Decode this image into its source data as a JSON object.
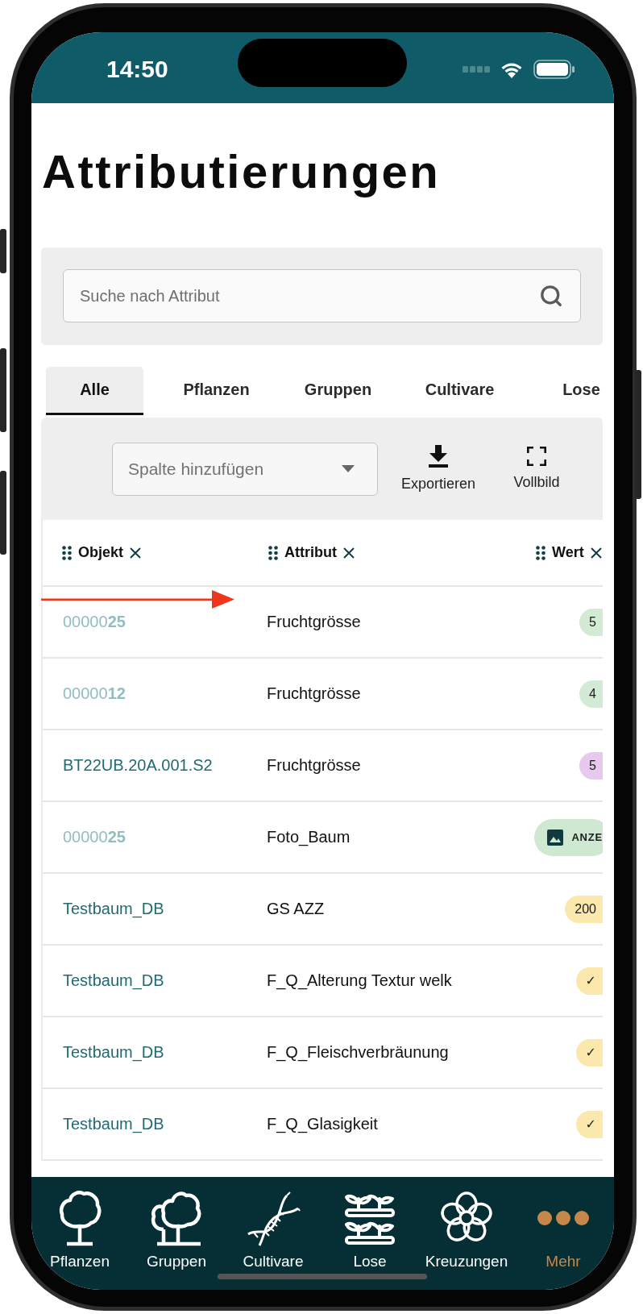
{
  "status_bar": {
    "time": "14:50"
  },
  "title": "Attributierungen",
  "search": {
    "placeholder": "Suche nach Attribut"
  },
  "tabs": [
    {
      "label": "Alle",
      "selected": true
    },
    {
      "label": "Pflanzen",
      "selected": false
    },
    {
      "label": "Gruppen",
      "selected": false
    },
    {
      "label": "Cultivare",
      "selected": false
    },
    {
      "label": "Lose",
      "selected": false
    }
  ],
  "toolbar": {
    "column_select": {
      "placeholder": "Spalte hinzufügen"
    },
    "buttons": [
      {
        "label": "Exportieren",
        "kind": "export"
      },
      {
        "label": "Vollbild",
        "kind": "fullscreen"
      }
    ]
  },
  "table": {
    "columns": [
      {
        "label": "Objekt"
      },
      {
        "label": "Attribut"
      },
      {
        "label": "Wert"
      }
    ],
    "rows": [
      {
        "object": {
          "text": "00000**25**",
          "kind": "padded"
        },
        "attribute": "Fruchtgrösse",
        "value": {
          "kind": "number",
          "text": "5",
          "color": "#d3ebd5"
        },
        "annotation": {
          "kind": "arrow"
        }
      },
      {
        "object": {
          "text": "00000**12**",
          "kind": "padded"
        },
        "attribute": "Fruchtgrösse",
        "value": {
          "kind": "number",
          "text": "4",
          "color": "#d3ebd5"
        }
      },
      {
        "object": {
          "text": "BT22UB.20A.001.S2",
          "kind": "name"
        },
        "attribute": "Fruchtgrösse",
        "value": {
          "kind": "number",
          "text": "5",
          "color": "#e6c9ec"
        }
      },
      {
        "object": {
          "text": "00000**25**",
          "kind": "padded"
        },
        "attribute": "Foto_Baum",
        "value": {
          "kind": "image",
          "text": "ANZE",
          "color": "#cfe8d2"
        }
      },
      {
        "object": {
          "text": "Testbaum_DB",
          "kind": "name"
        },
        "attribute": "GS AZZ",
        "value": {
          "kind": "number",
          "text": "200",
          "color": "#fbe8ad"
        }
      },
      {
        "object": {
          "text": "Testbaum_DB",
          "kind": "name"
        },
        "attribute": "F_Q_Alterung Textur welk",
        "value": {
          "kind": "check",
          "text": "✓",
          "color": "#fbe8ad"
        }
      },
      {
        "object": {
          "text": "Testbaum_DB",
          "kind": "name"
        },
        "attribute": "F_Q_Fleischverbräunung",
        "value": {
          "kind": "check",
          "text": "✓",
          "color": "#fbe8ad"
        }
      },
      {
        "object": {
          "text": "Testbaum_DB",
          "kind": "name"
        },
        "attribute": "F_Q_Glasigkeit",
        "value": {
          "kind": "check",
          "text": "✓",
          "color": "#fbe8ad"
        }
      }
    ]
  },
  "bottom_nav": [
    {
      "label": "Pflanzen",
      "kind": "tree",
      "selected": false
    },
    {
      "label": "Gruppen",
      "kind": "trees",
      "selected": false
    },
    {
      "label": "Cultivare",
      "kind": "dna",
      "selected": false
    },
    {
      "label": "Lose",
      "kind": "seedlings",
      "selected": false
    },
    {
      "label": "Kreuzungen",
      "kind": "flower",
      "selected": false
    },
    {
      "label": "Mehr",
      "kind": "more",
      "selected": true
    }
  ]
}
